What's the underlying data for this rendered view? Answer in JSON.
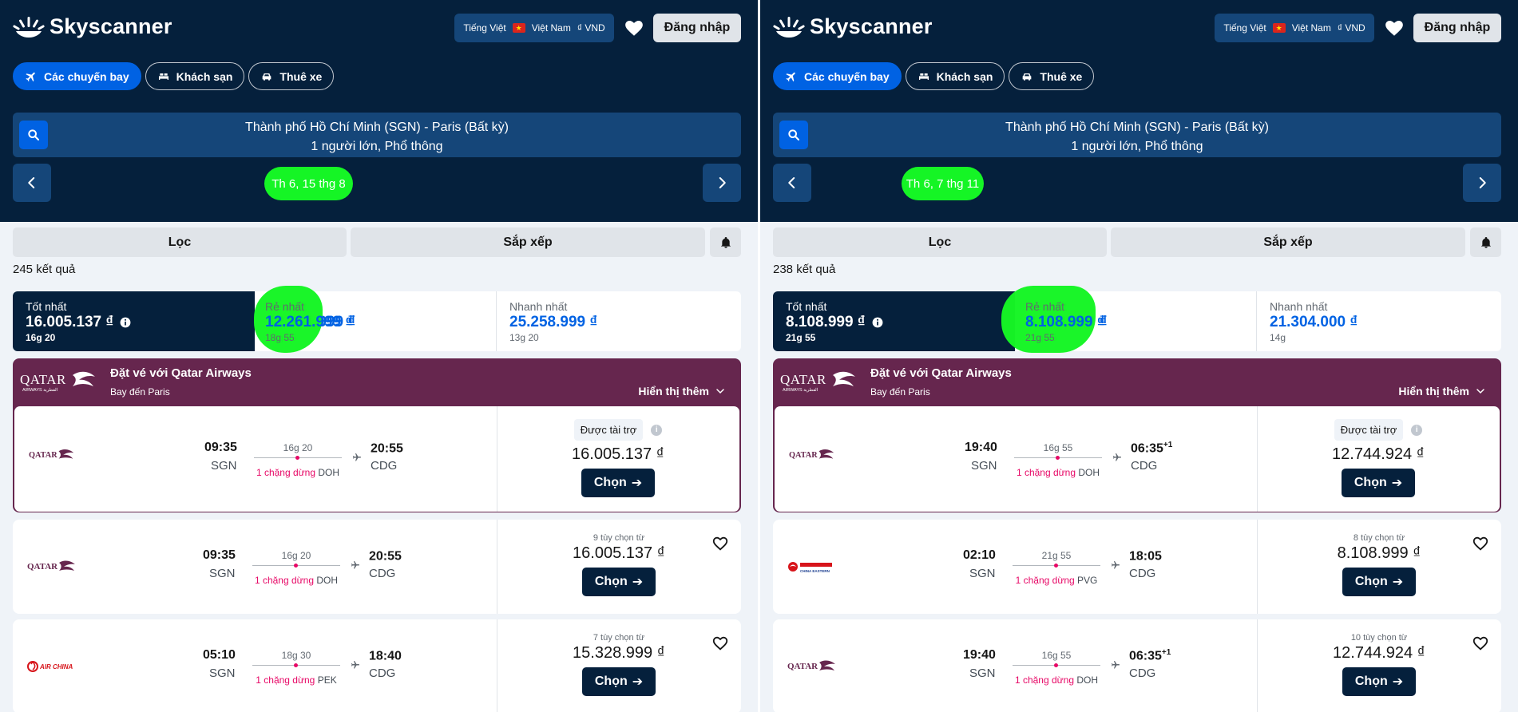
{
  "brand": {
    "name": "Skyscanner"
  },
  "header": {
    "language": "Tiếng Việt",
    "country": "Việt Nam",
    "currency": "₫ VND",
    "login_label": "Đăng nhập"
  },
  "tabs": [
    {
      "label": "Các chuyến bay",
      "icon": "plane-icon"
    },
    {
      "label": "Khách sạn",
      "icon": "bed-icon"
    },
    {
      "label": "Thuê xe",
      "icon": "car-icon"
    }
  ],
  "colors": {
    "navy": "#05203c",
    "blue": "#0062e3",
    "qatar": "#66264e",
    "highlight": "#15f525",
    "stop": "#e70866"
  },
  "left": {
    "route": "Thành phố Hồ Chí Minh (SGN) - Paris (Bất kỳ)",
    "pax": "1 người lớn, Phổ thông",
    "date": "Th 6, 15 thg 8",
    "filter_label": "Lọc",
    "sort_label": "Sắp xếp",
    "results": "245 kết quả",
    "summary": {
      "best": {
        "label": "Tốt nhất",
        "price": "16.005.137 ₫",
        "duration": "16g 20"
      },
      "cheapest": {
        "label": "Rẻ nhất",
        "price": "12.261.999 ₫",
        "duration": "18g 55"
      },
      "fastest": {
        "label": "Nhanh nhất",
        "price": "25.258.999 ₫",
        "duration": "13g 20"
      }
    },
    "sponsor": {
      "title": "Đặt vé với Qatar Airways",
      "subtitle": "Bay đến Paris",
      "more": "Hiển thị thêm",
      "badge": "Được tài trợ",
      "flight": {
        "dep": "09:35",
        "dep_code": "SGN",
        "arr": "20:55",
        "arr_suffix": "",
        "arr_code": "CDG",
        "duration": "16g 20",
        "stops": "1 chặng dừng",
        "via": "DOH",
        "price": "16.005.137 ₫",
        "choose": "Chọn"
      }
    },
    "flights": [
      {
        "airline": "Qatar Airways",
        "dep": "09:35",
        "dep_code": "SGN",
        "arr": "20:55",
        "arr_suffix": "",
        "arr_code": "CDG",
        "duration": "16g 20",
        "stops": "1 chặng dừng",
        "via": "DOH",
        "options": "9 tùy chọn từ",
        "price": "16.005.137 ₫",
        "choose": "Chọn"
      },
      {
        "airline": "Air China",
        "dep": "05:10",
        "dep_code": "SGN",
        "arr": "18:40",
        "arr_suffix": "",
        "arr_code": "CDG",
        "duration": "18g 30",
        "stops": "1 chặng dừng",
        "via": "PEK",
        "options": "7 tùy chọn từ",
        "price": "15.328.999 ₫",
        "choose": "Chọn"
      }
    ]
  },
  "right": {
    "route": "Thành phố Hồ Chí Minh (SGN) - Paris (Bất kỳ)",
    "pax": "1 người lớn, Phổ thông",
    "date": "Th 6, 7 thg 11",
    "filter_label": "Lọc",
    "sort_label": "Sắp xếp",
    "results": "238 kết quả",
    "summary": {
      "best": {
        "label": "Tốt nhất",
        "price": "8.108.999 ₫",
        "duration": "21g 55"
      },
      "cheapest": {
        "label": "Rẻ nhất",
        "price": "8.108.999 ₫",
        "duration": "21g 55"
      },
      "fastest": {
        "label": "Nhanh nhất",
        "price": "21.304.000 ₫",
        "duration": "14g"
      }
    },
    "sponsor": {
      "title": "Đặt vé với Qatar Airways",
      "subtitle": "Bay đến Paris",
      "more": "Hiển thị thêm",
      "badge": "Được tài trợ",
      "flight": {
        "dep": "19:40",
        "dep_code": "SGN",
        "arr": "06:35",
        "arr_suffix": "+1",
        "arr_code": "CDG",
        "duration": "16g 55",
        "stops": "1 chặng dừng",
        "via": "DOH",
        "price": "12.744.924 ₫",
        "choose": "Chọn"
      }
    },
    "flights": [
      {
        "airline": "China Eastern",
        "dep": "02:10",
        "dep_code": "SGN",
        "arr": "18:05",
        "arr_suffix": "",
        "arr_code": "CDG",
        "duration": "21g 55",
        "stops": "1 chặng dừng",
        "via": "PVG",
        "options": "8 tùy chọn từ",
        "price": "8.108.999 ₫",
        "choose": "Chọn"
      },
      {
        "airline": "Qatar Airways",
        "dep": "19:40",
        "dep_code": "SGN",
        "arr": "06:35",
        "arr_suffix": "+1",
        "arr_code": "CDG",
        "duration": "16g 55",
        "stops": "1 chặng dừng",
        "via": "DOH",
        "options": "10 tùy chọn từ",
        "price": "12.744.924 ₫",
        "choose": "Chọn"
      }
    ]
  }
}
